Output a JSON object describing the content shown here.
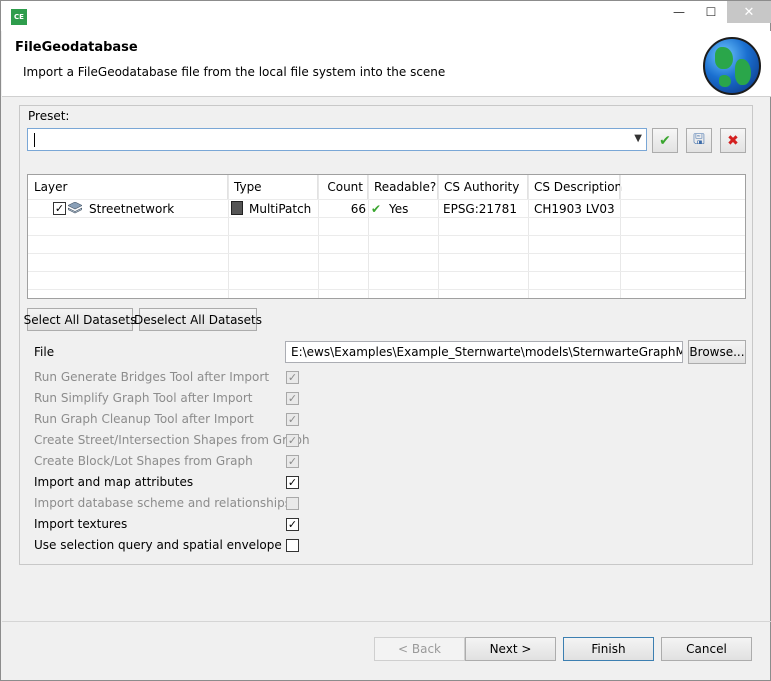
{
  "window": {
    "app_icon_text": "CE",
    "minimize": "—",
    "maximize": "☐",
    "close": "✕"
  },
  "header": {
    "title": "FileGeodatabase",
    "description": "Import a FileGeodatabase file from the local file system into the scene",
    "logo_icon": "globe-icon"
  },
  "preset": {
    "label": "Preset:",
    "value": "",
    "buttons": [
      {
        "name": "apply-preset",
        "icon": "check-icon",
        "glyph": "✔"
      },
      {
        "name": "save-preset",
        "icon": "floppy-icon",
        "glyph": "🖫"
      },
      {
        "name": "delete-preset",
        "icon": "red-x-icon",
        "glyph": "✖"
      }
    ]
  },
  "table": {
    "headers": [
      "Layer",
      "Type",
      "Count",
      "Readable?",
      "CS Authority",
      "CS Description"
    ],
    "rows": [
      {
        "checked": true,
        "layer": "Streetnetwork",
        "type": "MultiPatch",
        "count": "66",
        "readable": "Yes",
        "cs_authority": "EPSG:21781",
        "cs_description": "CH1903 LV03"
      }
    ]
  },
  "dataset_buttons": {
    "select_all": "Select All Datasets",
    "deselect_all": "Deselect All Datasets"
  },
  "file": {
    "label": "File",
    "value": "E:\\ews\\Examples\\Example_Sternwarte\\models\\SternwarteGraphMP.gdb",
    "browse": "Browse..."
  },
  "options": [
    {
      "label": "Run Generate Bridges Tool after Import",
      "checked": true,
      "enabled": false
    },
    {
      "label": "Run Simplify Graph Tool after Import",
      "checked": true,
      "enabled": false
    },
    {
      "label": "Run Graph Cleanup Tool after Import",
      "checked": true,
      "enabled": false
    },
    {
      "label": "Create Street/Intersection Shapes from Graph",
      "checked": true,
      "enabled": false
    },
    {
      "label": "Create Block/Lot Shapes from Graph",
      "checked": true,
      "enabled": false
    },
    {
      "label": "Import and map attributes",
      "checked": true,
      "enabled": true
    },
    {
      "label": "Import database scheme and relationships",
      "checked": false,
      "enabled": false
    },
    {
      "label": "Import textures",
      "checked": true,
      "enabled": true
    },
    {
      "label": "Use selection query and spatial envelope",
      "checked": false,
      "enabled": true
    }
  ],
  "footer": {
    "back": "< Back",
    "next": "Next >",
    "finish": "Finish",
    "cancel": "Cancel"
  },
  "colors": {
    "accent": "#3c7fb1",
    "apply_green": "#3aa62f",
    "delete_red": "#d42020"
  }
}
